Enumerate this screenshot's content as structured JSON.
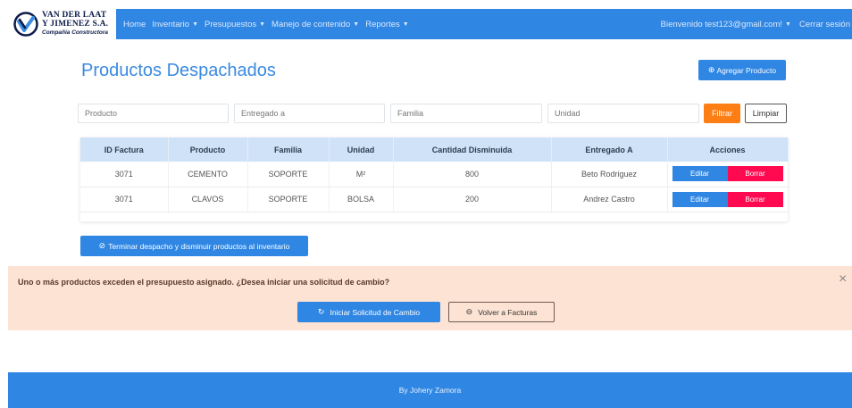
{
  "logo": {
    "line1": "VAN DER LAAT",
    "line2": "Y JIMENEZ S.A.",
    "line3": "Compañía Constructora",
    "colors": {
      "dark": "#0d1b4a",
      "light": "#3b8de0"
    }
  },
  "navbar": {
    "color": "#2f86e3",
    "items": [
      {
        "label": "Home",
        "dropdown": false
      },
      {
        "label": "Inventario",
        "dropdown": true
      },
      {
        "label": "Presupuestos",
        "dropdown": true
      },
      {
        "label": "Manejo de contenido",
        "dropdown": true
      },
      {
        "label": "Reportes",
        "dropdown": true
      }
    ],
    "welcome": "Bienvenido test123@gmail.com!",
    "logout": "Cerrar sesión"
  },
  "page": {
    "title": "Productos Despachados",
    "add_button": "Agregar Producto",
    "add_icon": "plus-circle-icon"
  },
  "filters": {
    "producto_placeholder": "Producto",
    "entregado_placeholder": "Entregado a",
    "familia_placeholder": "Familia",
    "unidad_placeholder": "Unidad",
    "filter_button": "Filtrar",
    "clear_button": "Limpiar",
    "filter_color": "#fd7e14"
  },
  "table": {
    "headers": [
      "ID Factura",
      "Producto",
      "Familia",
      "Unidad",
      "Cantidad Disminuida",
      "Entregado A",
      "Acciones"
    ],
    "rows": [
      {
        "id": "3071",
        "producto": "CEMENTO",
        "familia": "SOPORTE",
        "unidad": "M²",
        "cantidad": "800",
        "entregado": "Beto Rodriguez"
      },
      {
        "id": "3071",
        "producto": "CLAVOS",
        "familia": "SOPORTE",
        "unidad": "BOLSA",
        "cantidad": "200",
        "entregado": "Andrez Castro"
      }
    ],
    "edit_label": "Editar",
    "delete_label": "Borrar",
    "delete_color": "#ff0a50"
  },
  "finish_button": "Terminar despacho y disminuir productos al inventario",
  "alert": {
    "message": "Uno o más productos exceden el presupuesto asignado. ¿Desea iniciar una solicitud de cambio?",
    "start_button": "Iniciar Solicitud de Cambio",
    "back_button": "Volver a Facturas",
    "close_glyph": "×",
    "background": "#fde3d3"
  },
  "footer": {
    "text": "By Johery Zamora"
  }
}
